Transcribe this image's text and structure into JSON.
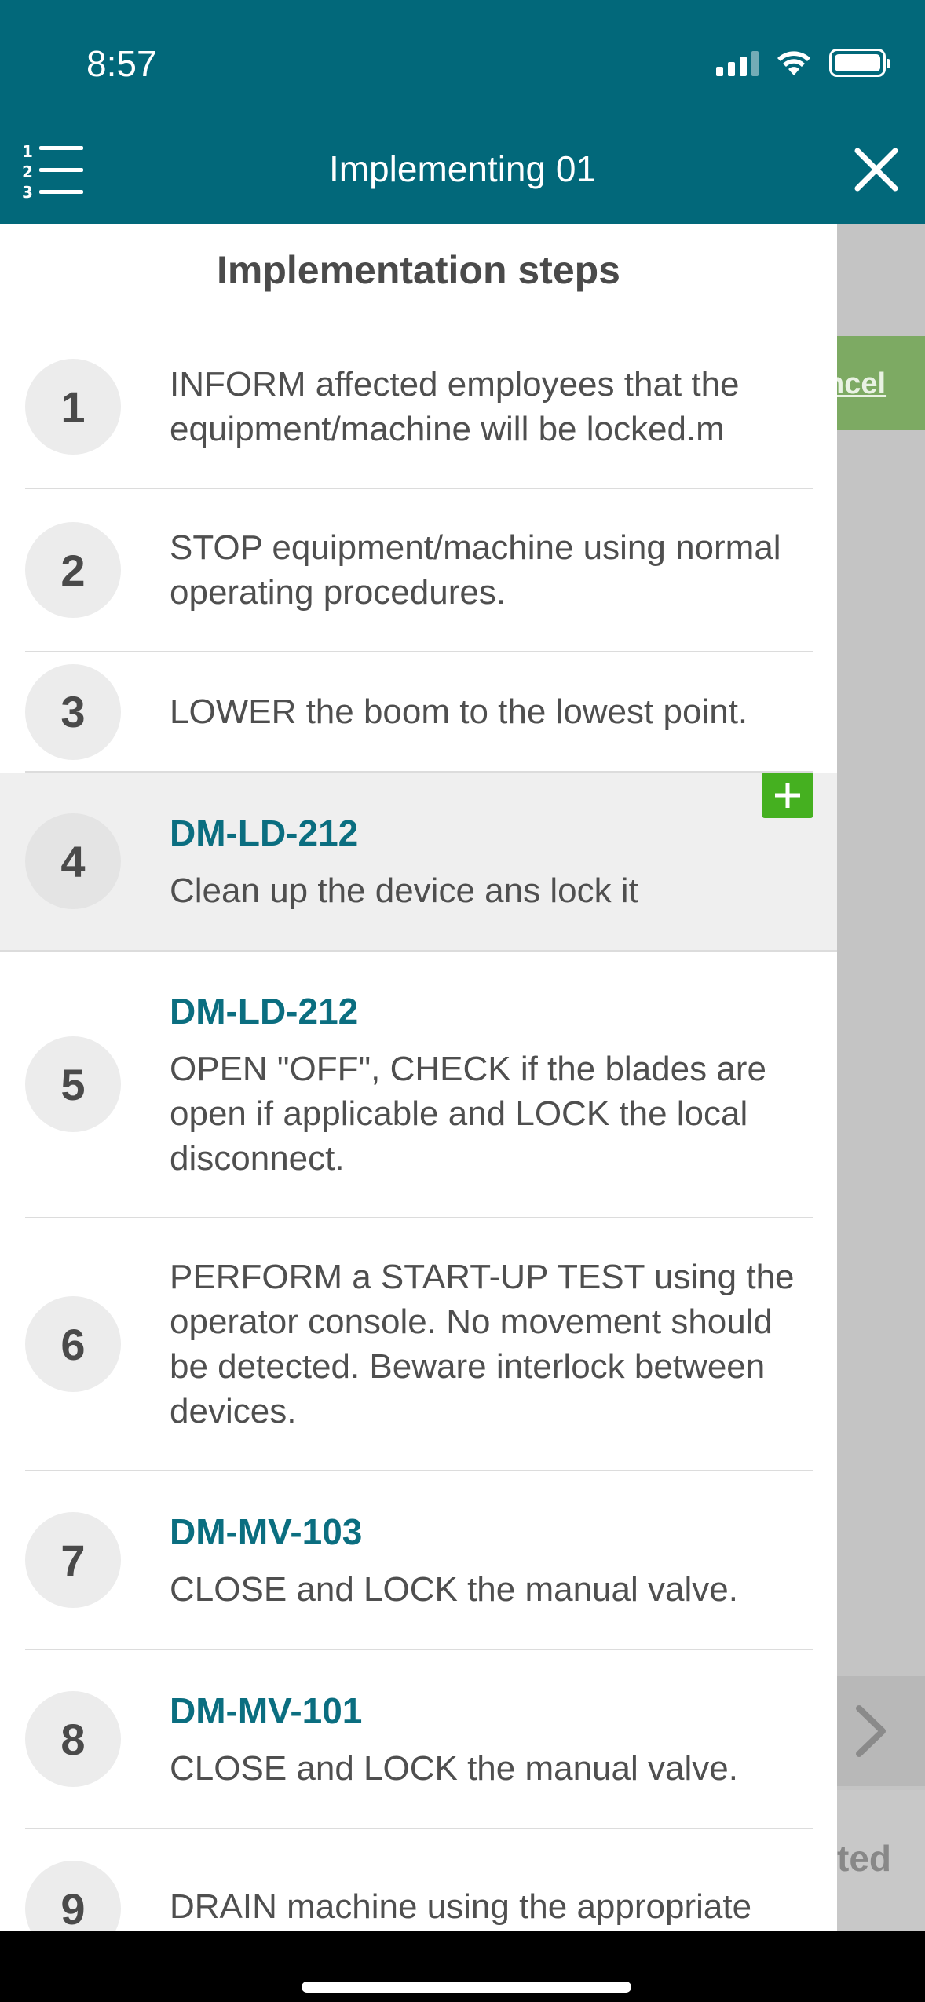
{
  "status_bar": {
    "time": "8:57"
  },
  "header": {
    "title": "Implementing 01"
  },
  "drawer": {
    "title": "Implementation steps",
    "steps": [
      {
        "number": "1",
        "code": "",
        "text": "INFORM affected employees that the equipment/machine will be locked.m"
      },
      {
        "number": "2",
        "code": "",
        "text": "STOP equipment/machine using normal operating procedures."
      },
      {
        "number": "3",
        "code": "",
        "text": "LOWER the boom to the lowest point."
      },
      {
        "number": "4",
        "code": "DM-LD-212",
        "text": "Clean up the device ans lock it"
      },
      {
        "number": "5",
        "code": "DM-LD-212",
        "text": "OPEN \"OFF\", CHECK if the blades are open if applicable and LOCK the local disconnect."
      },
      {
        "number": "6",
        "code": "",
        "text": "PERFORM a START-UP TEST using the operator console. No movement should be detected. Beware interlock between devices."
      },
      {
        "number": "7",
        "code": "DM-MV-103",
        "text": "CLOSE and LOCK the manual valve."
      },
      {
        "number": "8",
        "code": "DM-MV-101",
        "text": "CLOSE and LOCK the manual valve."
      },
      {
        "number": "9",
        "code": "",
        "text": "DRAIN machine using the appropriate method"
      }
    ]
  },
  "background": {
    "cancel_label": "ncel",
    "status_label": "ted"
  },
  "colors": {
    "header": "#02687a",
    "code": "#0b6e80",
    "add": "#45b020",
    "cancel": "#7daa63"
  }
}
